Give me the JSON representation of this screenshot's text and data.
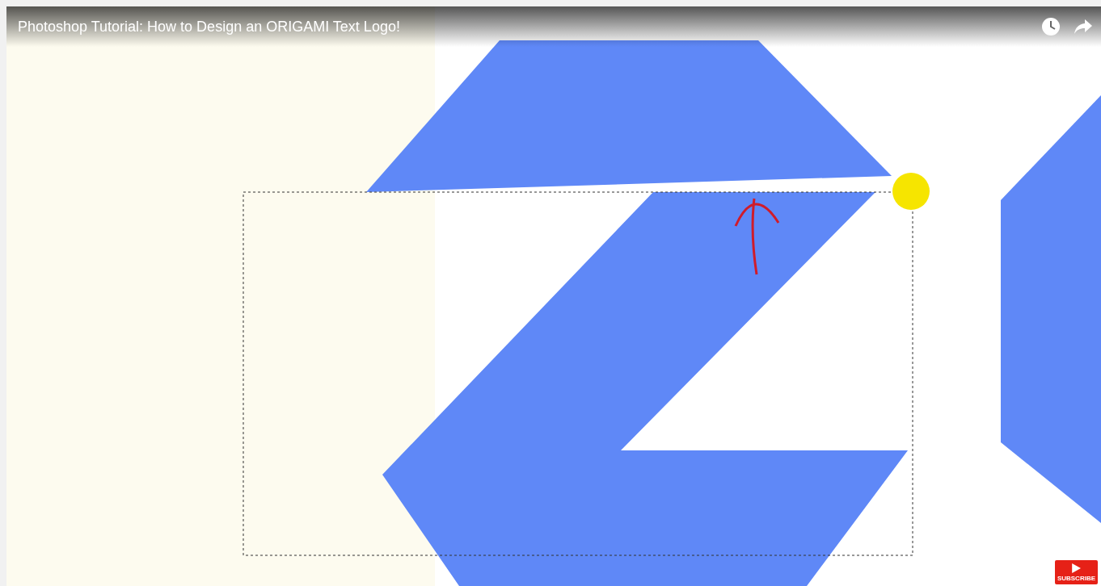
{
  "player": {
    "title": "Photoshop Tutorial: How to Design an ORIGAMI Text Logo!",
    "subscribe_label": "SUBSCRIBE"
  }
}
